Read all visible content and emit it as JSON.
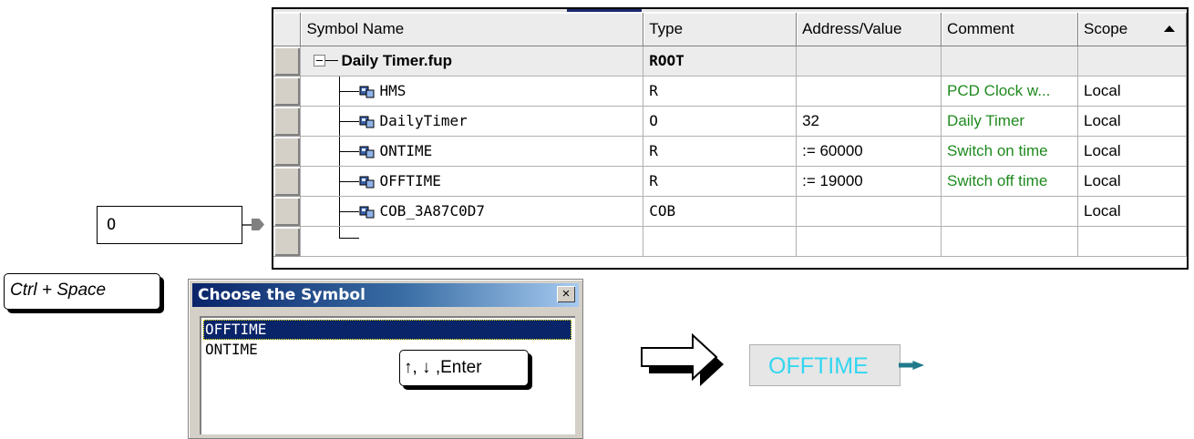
{
  "table": {
    "columns": [
      "Symbol Name",
      "Type",
      "Address/Value",
      "Comment",
      "Scope"
    ],
    "root": {
      "name": "Daily Timer.fup",
      "type": "ROOT"
    },
    "rows": [
      {
        "name": "HMS",
        "type": "R",
        "address": "",
        "comment": "PCD Clock w...",
        "scope": "Local"
      },
      {
        "name": "DailyTimer",
        "type": "O",
        "address": "32",
        "comment": "Daily Timer",
        "scope": "Local"
      },
      {
        "name": "ONTIME",
        "type": "R",
        "address": " := 60000",
        "comment": "Switch on time",
        "scope": "Local"
      },
      {
        "name": "OFFTIME",
        "type": "R",
        "address": " := 19000",
        "comment": "Switch off time",
        "scope": "Local"
      },
      {
        "name": "COB_3A87C0D7",
        "type": "COB",
        "address": "",
        "comment": "",
        "scope": "Local"
      }
    ]
  },
  "input_box": {
    "value": "O"
  },
  "keys": {
    "ctrl_space": "Ctrl + Space",
    "nav": "↑, ↓ ,Enter"
  },
  "dialog": {
    "title": "Choose the Symbol",
    "close": "×",
    "items": [
      "OFFTIME",
      "ONTIME"
    ],
    "selected": "OFFTIME"
  },
  "result": {
    "value": "OFFTIME"
  },
  "colors": {
    "comment_green": "#1e8a1e",
    "result_text": "#33d6f0",
    "title_bar": "#0a246a",
    "arrow_teal": "#1f7a8c"
  },
  "icons": [
    "symbol-icon",
    "expand-icon",
    "sort-asc-icon",
    "arrow-right-icon",
    "close-icon"
  ]
}
